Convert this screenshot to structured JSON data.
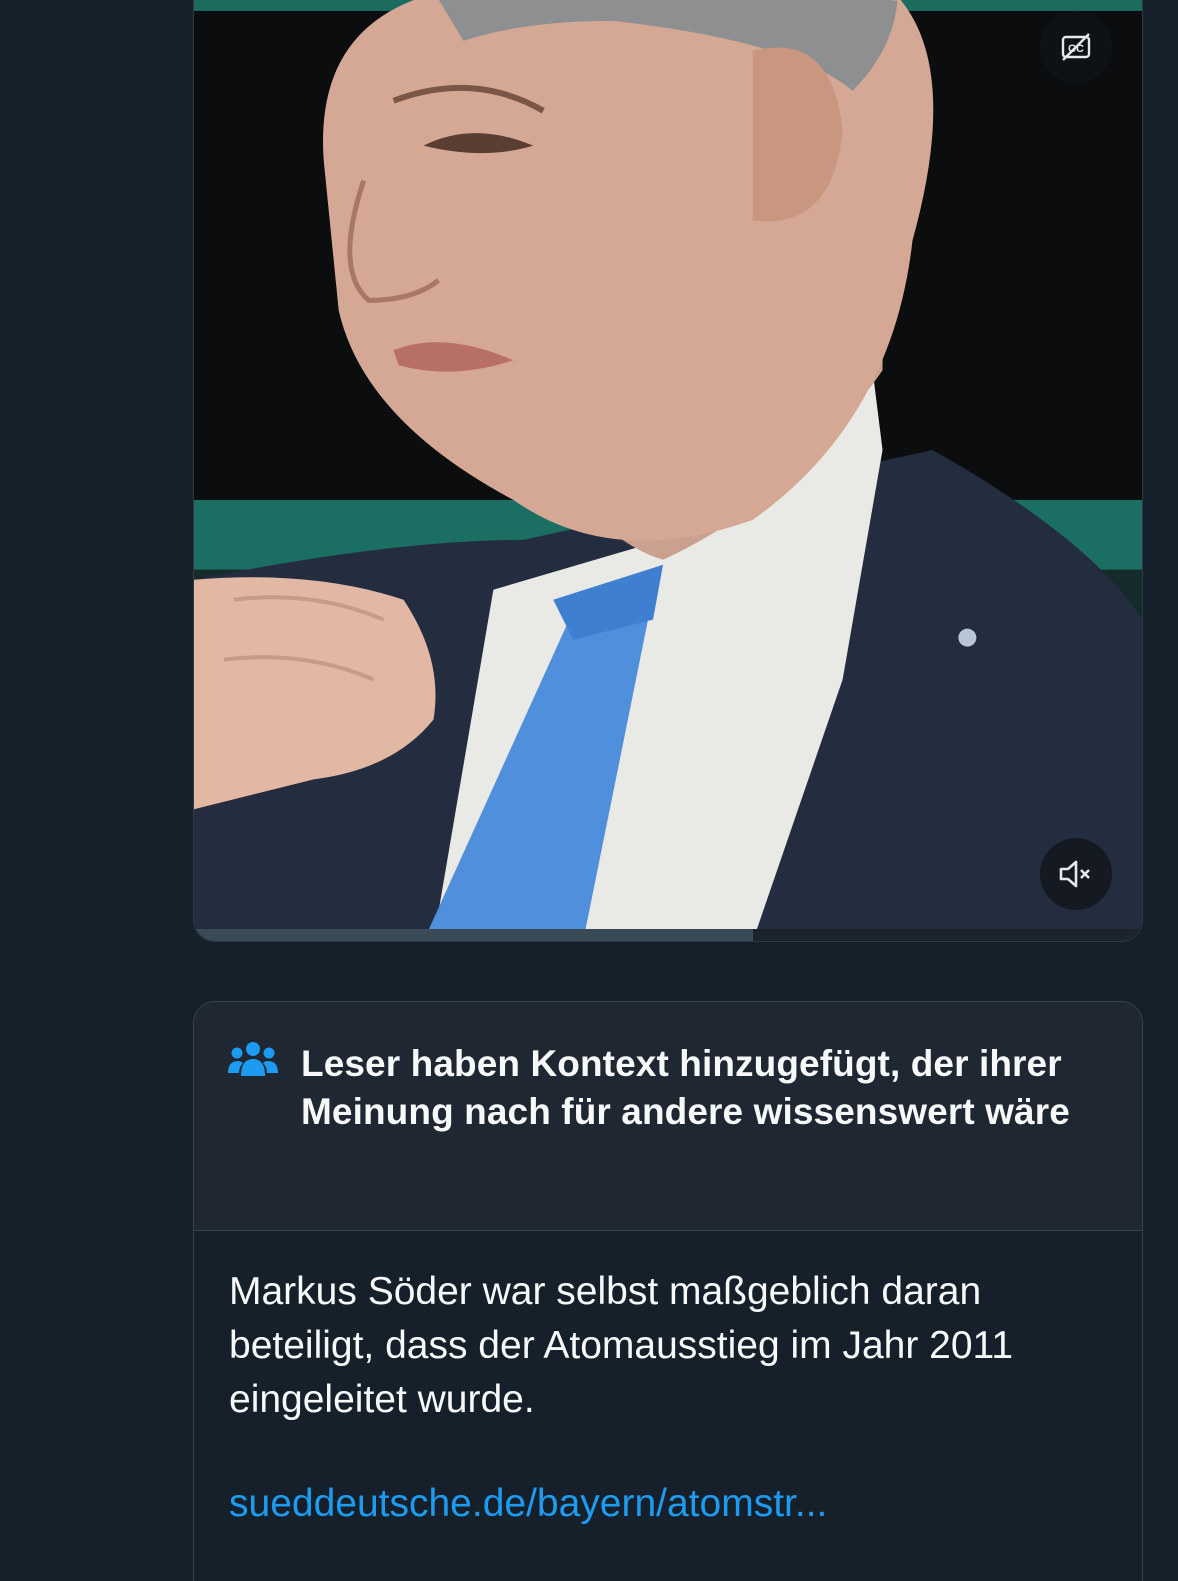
{
  "video": {
    "captions_icon": "captions-off-icon",
    "mute_icon": "speaker-muted-icon",
    "progress": 0.59
  },
  "note": {
    "icon": "people-icon",
    "title": "Leser haben Kontext hinzugefügt, der ihrer Meinung nach für andere wissenswert wäre",
    "text": "Markus Söder war selbst maßgeblich daran beteiligt, dass der Atomausstieg im Jahr 2011 eingeleitet wurde.",
    "link": "sueddeutsche.de/bayern/atomstr..."
  },
  "colors": {
    "background": "#15202b",
    "link": "#1d9bf0",
    "accent_icon": "#1d9bf0"
  }
}
